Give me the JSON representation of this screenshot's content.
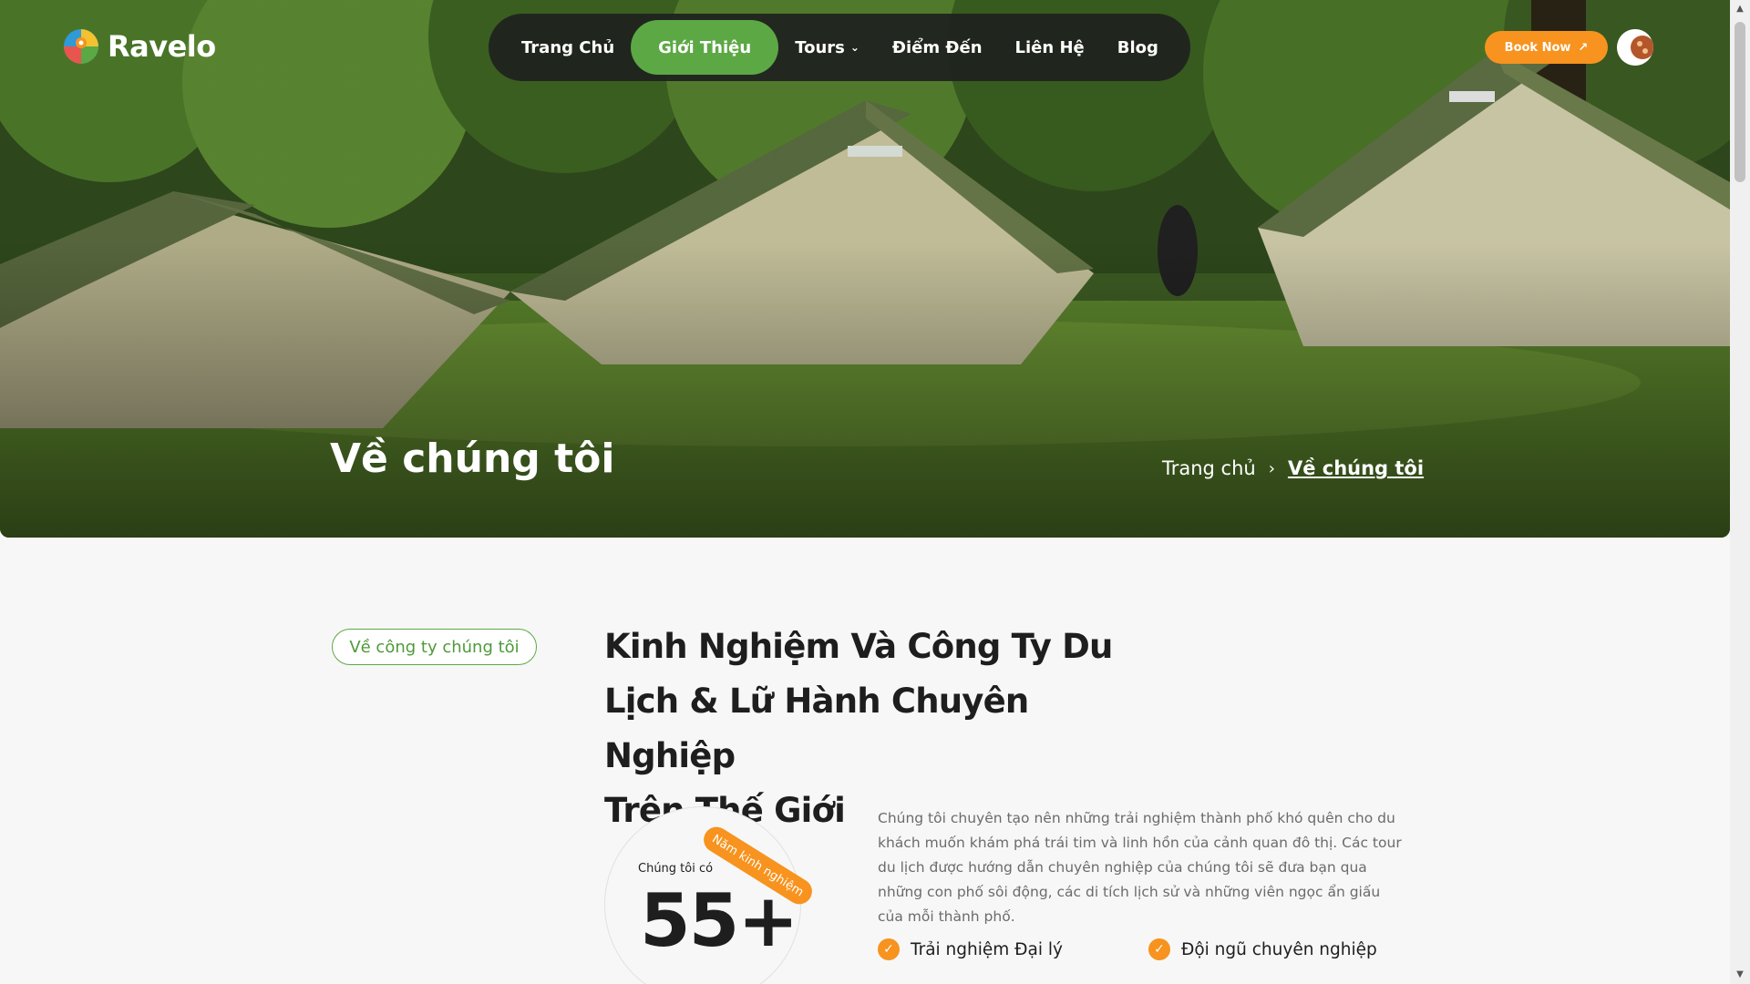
{
  "brand": {
    "name": "Ravelo"
  },
  "nav": {
    "items": [
      {
        "label": "Trang Chủ",
        "active": false
      },
      {
        "label": "Giới Thiệu",
        "active": true
      },
      {
        "label": "Tours",
        "active": false,
        "dropdown": true
      },
      {
        "label": "Điểm Đến",
        "active": false
      },
      {
        "label": "Liên Hệ",
        "active": false
      },
      {
        "label": "Blog",
        "active": false
      }
    ]
  },
  "header": {
    "book_label": "Book Now"
  },
  "hero": {
    "title": "Về chúng tôi",
    "breadcrumb": {
      "home": "Trang chủ",
      "current": "Về chúng tôi"
    }
  },
  "about": {
    "badge": "Về công ty chúng tôi",
    "headline_lines": [
      "Kinh Nghiệm Và Công Ty Du",
      "Lịch & Lữ Hành Chuyên Nghiệp",
      "Trên Thế Giới"
    ],
    "experience": {
      "prefix": "Chúng tôi có",
      "value": "55+",
      "tag": "Năm kinh nghiệm"
    },
    "description": "Chúng tôi chuyên tạo nên những trải nghiệm thành phố khó quên cho du khách muốn khám phá trái tim và linh hồn của cảnh quan đô thị. Các tour du lịch được hướng dẫn chuyên nghiệp của chúng tôi sẽ đưa bạn qua những con phố sôi động, các di tích lịch sử và những viên ngọc ẩn giấu của mỗi thành phố.",
    "features": [
      "Trải nghiệm Đại lý",
      "Đội ngũ chuyên nghiệp"
    ]
  },
  "colors": {
    "green": "#5ca845",
    "orange": "#f7931e",
    "dark": "#1e1e1e"
  }
}
